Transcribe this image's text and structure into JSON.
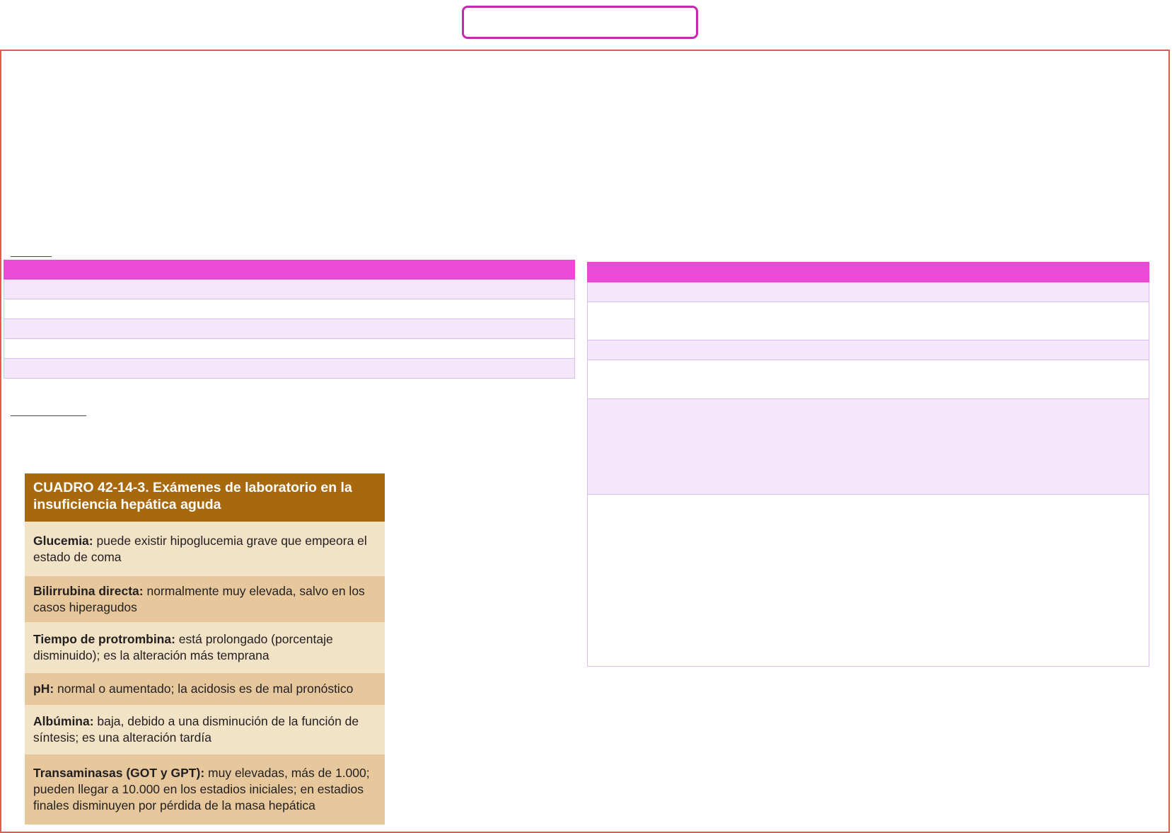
{
  "colors": {
    "title_box_border": "#c22ab0",
    "frame_border": "#e05a4e",
    "table_header": "#ea4ad6",
    "table_alt_row": "#f5e7fb",
    "lab_title_bg": "#a8680c",
    "lab_row_light": "#f2e2c6",
    "lab_row_dark": "#e6c89c"
  },
  "lab_table": {
    "title": "CUADRO 42-14-3. Exámenes de laboratorio en la insuficiencia hepática aguda",
    "rows": [
      {
        "term": "Glucemia:",
        "text": " puede existir hipoglucemia grave que empeora el estado de coma"
      },
      {
        "term": "Bilirrubina directa:",
        "text": " normalmente muy elevada, salvo en los casos hiperagudos"
      },
      {
        "term": "Tiempo de protrombina:",
        "text": " está prolongado (porcentaje disminuido); es la alteración más temprana"
      },
      {
        "term": "pH:",
        "text": " normal o aumentado; la acidosis es de mal pronóstico"
      },
      {
        "term": "Albúmina:",
        "text": " baja, debido a una disminución de la función de síntesis; es una alteración tardía"
      },
      {
        "term": "Transaminasas (GOT y GPT):",
        "text": " muy elevadas, más de 1.000; pueden llegar a 10.000 en los estadios iniciales; en estadios finales disminuyen por pérdida de la masa hepática"
      }
    ]
  }
}
